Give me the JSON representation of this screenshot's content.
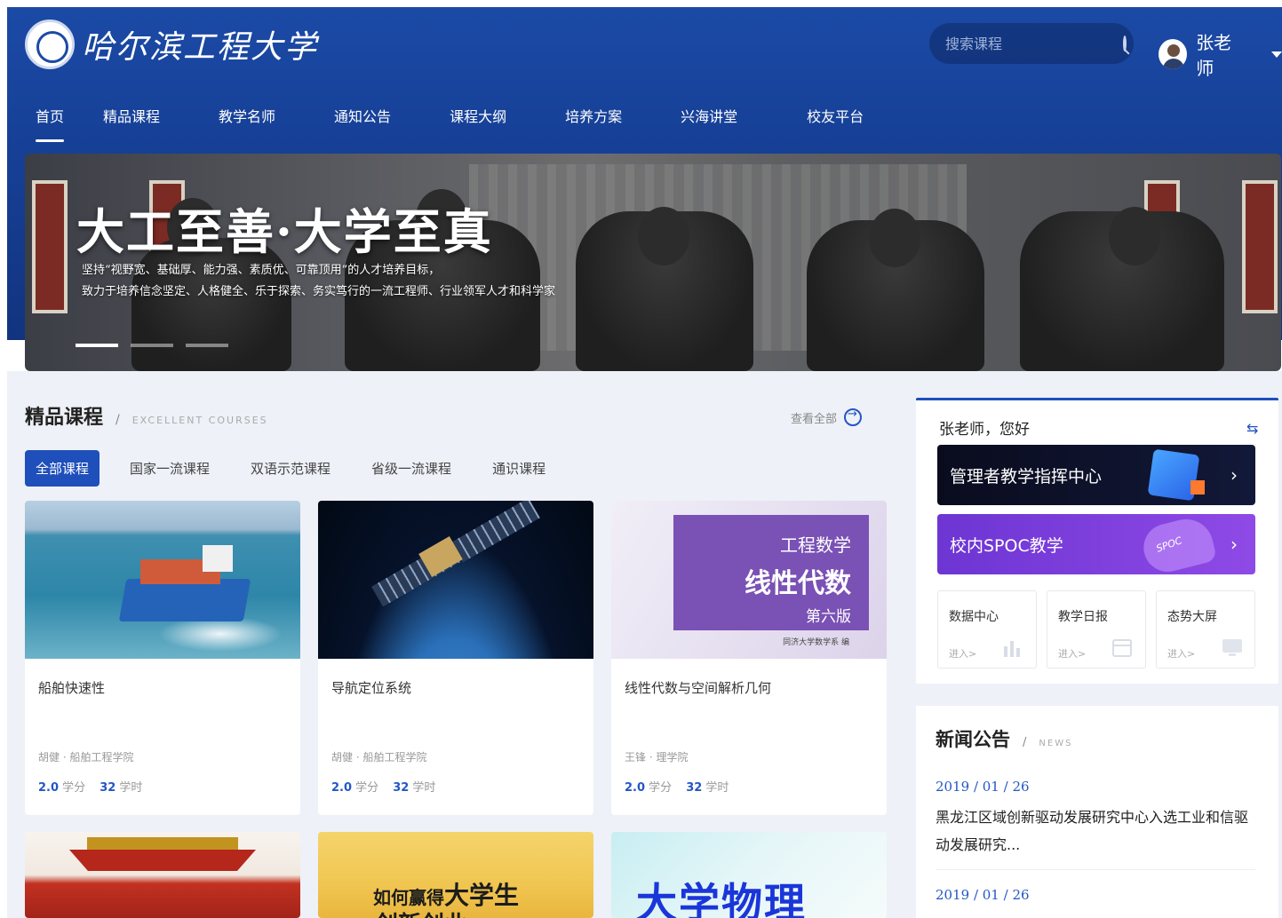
{
  "header": {
    "logo_text": "哈尔滨工程大学",
    "search_placeholder": "搜索课程",
    "user_name": "张老师"
  },
  "nav": {
    "items": [
      "首页",
      "精品课程",
      "教学名师",
      "通知公告",
      "课程大纲",
      "培养方案",
      "兴海讲堂",
      "校友平台"
    ],
    "active": "首页"
  },
  "banner": {
    "title": "大工至善·大学至真",
    "line1": "坚持“视野宽、基础厚、能力强、素质优、可靠顶用”的人才培养目标，",
    "line2": "致力于培养信念坚定、人格健全、乐于探索、务实笃行的一流工程师、行业领军人才和科学家"
  },
  "courses_section": {
    "title": "精品课程",
    "separator": "/",
    "subtitle": "EXCELLENT COURSES",
    "view_all": "查看全部",
    "filters": [
      "全部课程",
      "国家一流课程",
      "双语示范课程",
      "省级一流课程",
      "通识课程"
    ],
    "active_filter": "全部课程",
    "credit_unit": "学分",
    "hours_unit": "学时",
    "cards": [
      {
        "title": "船舶快速性",
        "author": "胡健 · 船舶工程学院",
        "credits": "2.0",
        "hours": "32"
      },
      {
        "title": "导航定位系统",
        "author": "胡健 · 船舶工程学院",
        "credits": "2.0",
        "hours": "32"
      },
      {
        "title": "线性代数与空间解析几何",
        "author": "王锋 · 理学院",
        "credits": "2.0",
        "hours": "32"
      }
    ],
    "math_cover": {
      "line1": "工程数学",
      "line2": "线性代数",
      "line3": "第六版",
      "publisher": "同济大学数学系 编"
    },
    "career_cover": {
      "line1_a": "如何赢得",
      "line1_b": "大学生",
      "line2": "创新创业"
    },
    "physics_cover": {
      "text": "大学物理"
    }
  },
  "panel": {
    "greeting": "张老师，您好",
    "swap_icon": "⇆",
    "button1": "管理者教学指挥中心",
    "button2": "校内SPOC教学",
    "spoc_tag": "SPOC",
    "chevron": "›",
    "minis": [
      {
        "title": "数据中心",
        "enter": "进入>"
      },
      {
        "title": "教学日报",
        "enter": "进入>"
      },
      {
        "title": "态势大屏",
        "enter": "进入>"
      }
    ]
  },
  "news": {
    "title": "新闻公告",
    "separator": "/",
    "subtitle": "NEWS",
    "items": [
      {
        "date": "2019 / 01 / 26",
        "text": "黑龙江区域创新驱动发展研究中心入选工业和信驱动发展研究..."
      },
      {
        "date": "2019 / 01 / 26",
        "text": ""
      }
    ]
  },
  "colors": {
    "header_blue": "#1b4aa6",
    "accent_blue": "#1f4fbb",
    "link_blue": "#2456c7",
    "spoc_purple": "#7a3fdd"
  }
}
